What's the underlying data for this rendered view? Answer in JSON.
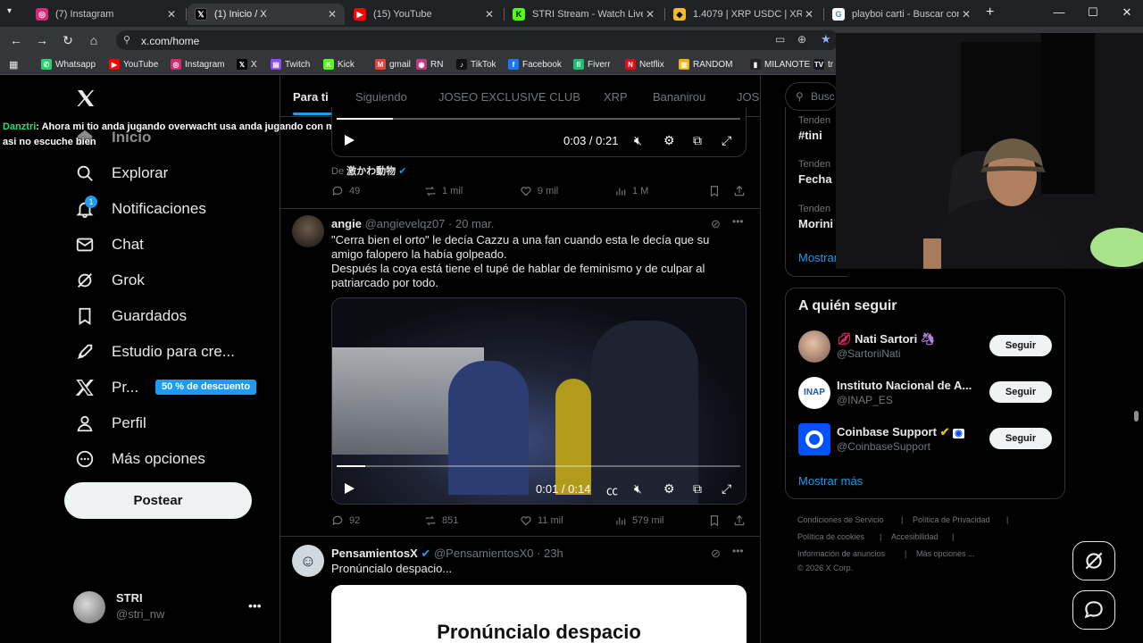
{
  "browser": {
    "tabs": [
      {
        "title": "(7) Instagram",
        "icon": "instagram-icon",
        "color": "#d62976"
      },
      {
        "title": "(1) Inicio / X",
        "icon": "x-icon",
        "color": "#000000",
        "active": true
      },
      {
        "title": "(15) YouTube",
        "icon": "youtube-icon",
        "color": "#ff0000"
      },
      {
        "title": "STRI Stream - Watch Live on",
        "icon": "kick-icon",
        "color": "#53fc18"
      },
      {
        "title": "1.4079 | XRP USDC | XRP to",
        "icon": "binance-icon",
        "color": "#f3ba2f"
      },
      {
        "title": "playboi carti - Buscar con G",
        "icon": "google-icon",
        "color": "#ffffff"
      }
    ],
    "url": "x.com/home",
    "bookmarks": [
      {
        "label": "Whatsapp",
        "icon": "whatsapp-icon",
        "color": "#25d366"
      },
      {
        "label": "YouTube",
        "icon": "youtube-icon",
        "color": "#ff0000"
      },
      {
        "label": "Instagram",
        "icon": "instagram-icon",
        "color": "#d62976"
      },
      {
        "label": "X",
        "icon": "x-icon",
        "color": "#000000"
      },
      {
        "label": "Twitch",
        "icon": "twitch-icon",
        "color": "#9146ff"
      },
      {
        "label": "Kick",
        "icon": "kick-icon",
        "color": "#53fc18"
      },
      {
        "label": "gmail",
        "icon": "gmail-icon",
        "color": "#ea4335"
      },
      {
        "label": "RN",
        "icon": "rn-icon",
        "color": "#c13584"
      },
      {
        "label": "TikTok",
        "icon": "tiktok-icon",
        "color": "#111111"
      },
      {
        "label": "Facebook",
        "icon": "facebook-icon",
        "color": "#1877f2"
      },
      {
        "label": "Fiverr",
        "icon": "fiverr-icon",
        "color": "#1dbf73"
      },
      {
        "label": "Netflix",
        "icon": "netflix-icon",
        "color": "#e50914"
      },
      {
        "label": "RANDOM",
        "icon": "folder-icon",
        "color": "#f4b400"
      },
      {
        "label": "MILANOTE",
        "icon": "milanote-icon",
        "color": "#222222"
      },
      {
        "label": "tr",
        "icon": "tradingview-icon",
        "color": "#131722"
      }
    ]
  },
  "chat": {
    "username": "Danztri",
    "message": ": Ahora mi tio anda jugando overwacht usa anda jugando con misuti o algo asi no escuche bien"
  },
  "sidebar": {
    "home_label": "Inicio",
    "items": [
      {
        "label": "Explorar",
        "icon": "search-icon"
      },
      {
        "label": "Notificaciones",
        "icon": "bell-icon",
        "badge": "1"
      },
      {
        "label": "Chat",
        "icon": "mail-icon"
      },
      {
        "label": "Grok",
        "icon": "grok-icon"
      },
      {
        "label": "Guardados",
        "icon": "bookmark-icon"
      },
      {
        "label": "Estudio para cre...",
        "icon": "rocket-icon"
      },
      {
        "label": "Pr...",
        "icon": "x-premium-icon"
      },
      {
        "label": "Perfil",
        "icon": "person-icon"
      },
      {
        "label": "Más opciones",
        "icon": "more-circle-icon"
      }
    ],
    "promo_badge": "50 % de descuento",
    "post_button": "Postear",
    "account": {
      "name": "STRI",
      "handle": "@stri_nw"
    }
  },
  "feed": {
    "tabs": [
      "Para ti",
      "Siguiendo",
      "JOSEO EXCLUSIVE CLUB",
      "XRP",
      "Bananirou",
      "JOS"
    ],
    "post1": {
      "video_time": "0:03 / 0:21",
      "video_progress": 0.14,
      "from_label": "De",
      "from_account": "激かわ動物",
      "replies": "49",
      "reposts": "1 mil",
      "likes": "9 mil",
      "views": "1 M"
    },
    "post2": {
      "name": "angie",
      "handle": "@angievelqz07",
      "date": "· 20 mar.",
      "text_line1": "\"Cerra bien el orto\" le decía Cazzu a una fan cuando esta le decía que su",
      "text_line2": "amigo falopero la había golpeado.",
      "text_line3": "Después la coya está tiene el tupé de hablar de feminismo y de culpar al",
      "text_line4": "patriarcado por todo.",
      "video_time": "0:01 / 0:14",
      "video_progress": 0.07,
      "replies": "92",
      "reposts": "851",
      "likes": "11 mil",
      "views": "579 mil"
    },
    "post3": {
      "name": "PensamientosX",
      "handle": "@PensamientosX0",
      "date": "· 23h",
      "text": "Pronúncialo despacio...",
      "image_text": "Pronúncialo despacio"
    }
  },
  "right": {
    "search_placeholder": "Busc",
    "trends": [
      {
        "category": "Tenden",
        "name": "#tini"
      },
      {
        "category": "Tenden",
        "name": "Fecha"
      },
      {
        "category": "Tenden",
        "name": "Morini"
      }
    ],
    "show_more_trends": "Mostrar",
    "who_to_follow_title": "A quién seguir",
    "follow": [
      {
        "name": "Nati Sartori",
        "handle": "@SartoriiNati",
        "button": "Seguir"
      },
      {
        "name": "Instituto Nacional de A...",
        "handle": "@INAP_ES",
        "button": "Seguir"
      },
      {
        "name": "Coinbase Support",
        "handle": "@CoinbaseSupport",
        "button": "Seguir"
      }
    ],
    "show_more": "Mostrar más",
    "footer": {
      "terms": "Condiciones de Servicio",
      "privacy": "Política de Privacidad",
      "cookies": "Política de cookies",
      "accessibility": "Accesibilidad",
      "ads": "Información de anuncios",
      "more": "Más opciones ...",
      "copyright": "© 2026 X Corp."
    }
  },
  "colors": {
    "accent": "#1d9bf0",
    "background": "#000000",
    "border": "#2f3336",
    "muted": "#71767b",
    "chat_username": "#29e06e"
  }
}
